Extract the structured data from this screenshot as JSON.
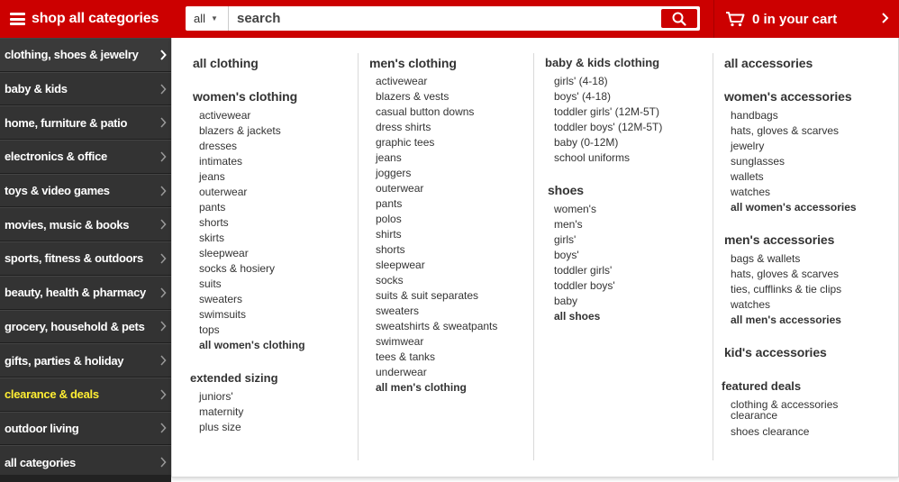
{
  "header": {
    "shop_all_label": "shop all categories",
    "search_scope": "all",
    "search_placeholder": "search",
    "cart_label": "0 in your cart"
  },
  "sidebar": {
    "items": [
      {
        "label": "clothing, shoes & jewelry"
      },
      {
        "label": "baby & kids"
      },
      {
        "label": "home, furniture & patio"
      },
      {
        "label": "electronics & office"
      },
      {
        "label": "toys & video games"
      },
      {
        "label": "movies, music & books"
      },
      {
        "label": "sports, fitness & outdoors"
      },
      {
        "label": "beauty, health & pharmacy"
      },
      {
        "label": "grocery, household & pets"
      },
      {
        "label": "gifts, parties & holiday"
      },
      {
        "label": "clearance & deals"
      },
      {
        "label": "outdoor living"
      },
      {
        "label": "all categories"
      }
    ],
    "highlight_color": "#ffee33"
  },
  "col1": {
    "all_clothing": "all clothing",
    "womens_heading": "women's clothing",
    "womens": [
      "activewear",
      "blazers & jackets",
      "dresses",
      "intimates",
      "jeans",
      "outerwear",
      "pants",
      "shorts",
      "skirts",
      "sleepwear",
      "socks & hosiery",
      "suits",
      "sweaters",
      "swimsuits",
      "tops"
    ],
    "all_womens": "all women's clothing",
    "extended_heading": "extended sizing",
    "extended": [
      "juniors'",
      "maternity",
      "plus size"
    ]
  },
  "col2": {
    "mens_heading": "men's clothing",
    "mens": [
      "activewear",
      "blazers & vests",
      "casual button downs",
      "dress shirts",
      "graphic tees",
      "jeans",
      "joggers",
      "outerwear",
      "pants",
      "polos",
      "shirts",
      "shorts",
      "sleepwear",
      "socks",
      "suits & suit separates",
      "sweaters",
      "sweatshirts & sweatpants",
      "swimwear",
      "tees & tanks",
      "underwear"
    ],
    "all_mens": "all men's clothing"
  },
  "col3": {
    "baby_heading": "baby & kids clothing",
    "baby": [
      "girls' (4-18)",
      "boys' (4-18)",
      "toddler girls' (12M-5T)",
      "toddler boys' (12M-5T)",
      "baby (0-12M)",
      "school uniforms"
    ],
    "shoes_heading": "shoes",
    "shoes": [
      "women's",
      "men's",
      "girls'",
      "boys'",
      "toddler girls'",
      "toddler boys'",
      "baby"
    ],
    "all_shoes": "all shoes"
  },
  "col4": {
    "all_accessories": "all accessories",
    "womens_acc_heading": "women's accessories",
    "womens_acc": [
      "handbags",
      "hats, gloves & scarves",
      "jewelry",
      "sunglasses",
      "wallets",
      "watches"
    ],
    "all_womens_acc": "all women's accessories",
    "mens_acc_heading": "men's accessories",
    "mens_acc": [
      "bags & wallets",
      "hats, gloves & scarves",
      "ties, cufflinks & tie clips",
      "watches"
    ],
    "all_mens_acc": "all men's accessories",
    "kids_acc_heading": "kid's accessories",
    "featured_heading": "featured deals",
    "featured_1": "clothing & accessories clearance",
    "featured_2": "shoes clearance"
  },
  "colors": {
    "brand_red": "#cc0000",
    "sidebar_bg": "#333333"
  }
}
